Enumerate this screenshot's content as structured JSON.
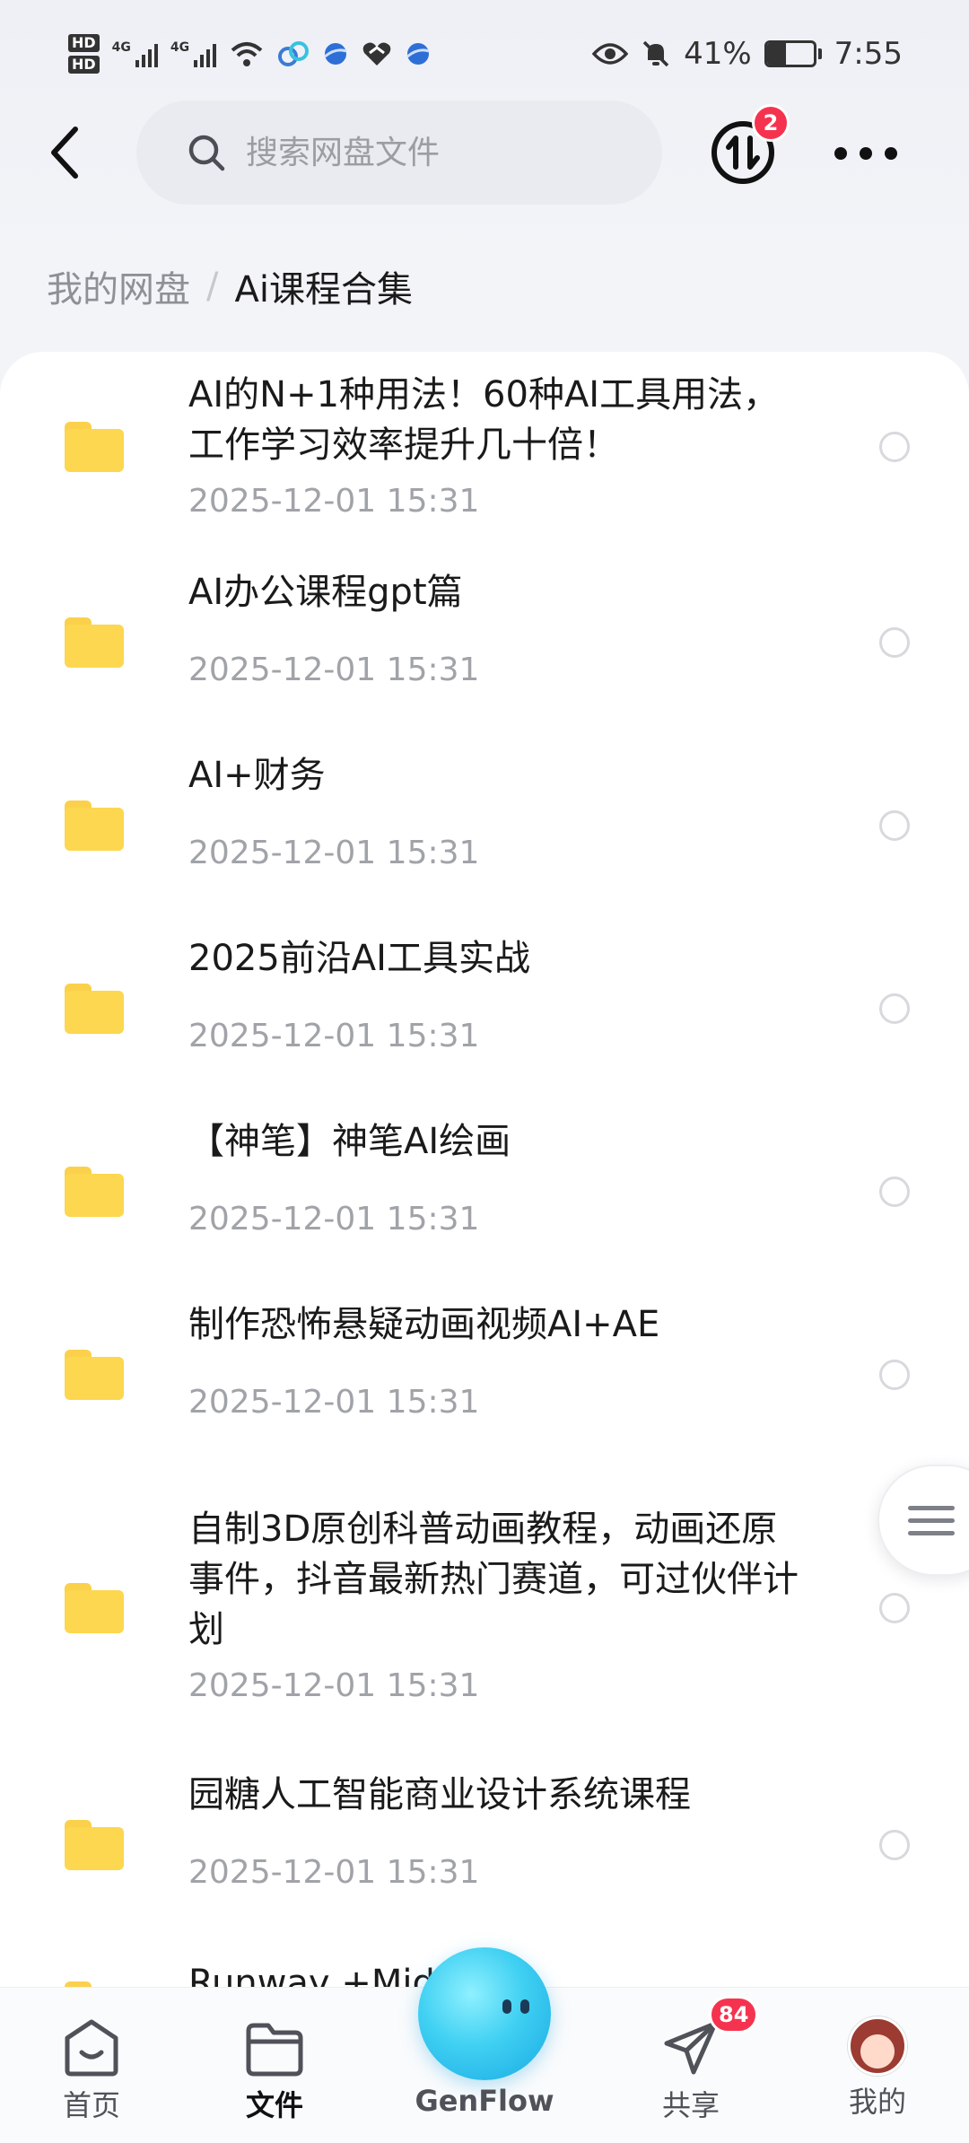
{
  "status_bar": {
    "hd1": "HD",
    "hd2": "HD",
    "net1": "4G",
    "net2": "4G",
    "battery_pct": "41%",
    "battery_level": 0.41,
    "time": "7:55"
  },
  "top_bar": {
    "search_placeholder": "搜索网盘文件",
    "transfer_badge": "2"
  },
  "breadcrumb": {
    "root": "我的网盘",
    "separator": "/",
    "current": "Ai课程合集"
  },
  "files": [
    {
      "name": "AI的N+1种用法！60种AI工具用法，工作学习效率提升几十倍！",
      "date": "2025-12-01  15:31"
    },
    {
      "name": "AI办公课程gpt篇",
      "date": "2025-12-01  15:31"
    },
    {
      "name": "AI+财务",
      "date": "2025-12-01  15:31"
    },
    {
      "name": "2025前沿AI工具实战",
      "date": "2025-12-01  15:31"
    },
    {
      "name": "【神笔】神笔AI绘画",
      "date": "2025-12-01  15:31"
    },
    {
      "name": "制作恐怖悬疑动画视频AI+AE",
      "date": "2025-12-01  15:31"
    },
    {
      "name": "自制3D原创科普动画教程，动画还原事件，抖音最新热门赛道，可过伙伴计划",
      "date": "2025-12-01  15:31"
    },
    {
      "name": "园糖人工智能商业设计系统课程",
      "date": "2025-12-01  15:31"
    },
    {
      "name": "Runway +Midj",
      "date": ""
    }
  ],
  "bottom_nav": {
    "home": "首页",
    "files": "文件",
    "genflow": "GenFlow",
    "share": "共享",
    "share_badge": "84",
    "mine": "我的"
  },
  "colors": {
    "folder": "#fcd74f",
    "badge": "#f5334f",
    "accent_genflow": "#3fd0f2"
  }
}
